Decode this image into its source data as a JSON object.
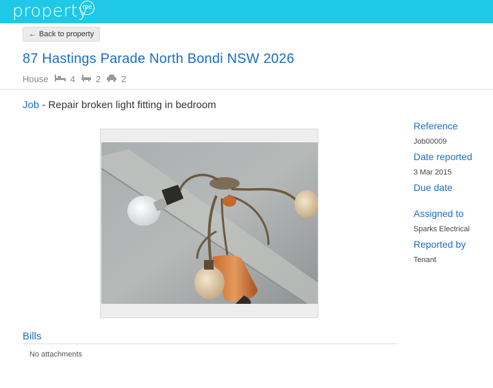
{
  "header": {
    "logo_text": "property",
    "logo_badge": "me",
    "brand_color": "#1fc8e6"
  },
  "nav": {
    "back_label": "Back to property"
  },
  "property": {
    "address": "87 Hastings Parade North Bondi NSW 2026",
    "type": "House",
    "bedrooms": "4",
    "bathrooms": "2",
    "car_spaces": "2",
    "icons": [
      "bed-icon",
      "bath-icon",
      "car-icon"
    ]
  },
  "job": {
    "label": "Job",
    "separator": " - ",
    "title": "Repair broken light fitting in bedroom"
  },
  "details": {
    "reference_label": "Reference",
    "reference_value": "Job00009",
    "date_reported_label": "Date reported",
    "date_reported_value": "3 Mar 2015",
    "due_date_label": "Due date",
    "assigned_to_label": "Assigned to",
    "assigned_to_value": "Sparks Electrical",
    "reported_by_label": "Reported by",
    "reported_by_value": "Tenant"
  },
  "bills": {
    "title": "Bills",
    "empty_text": "No attachments"
  },
  "colors": {
    "link": "#1a6ec0",
    "text": "#333333",
    "muted": "#888888"
  }
}
